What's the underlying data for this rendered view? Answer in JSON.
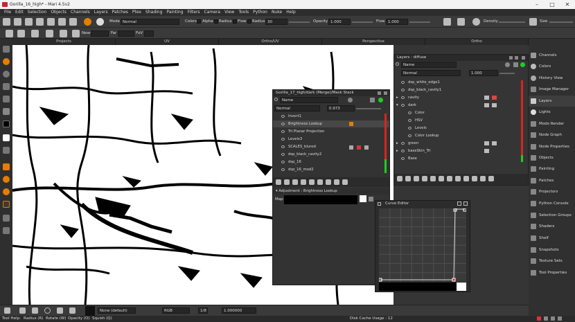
{
  "window": {
    "title": "Gorilla_16_high* - Mari 4.5v2"
  },
  "menu": [
    "File",
    "Edit",
    "Selection",
    "Objects",
    "Channels",
    "Layers",
    "Patches",
    "Ptex",
    "Shading",
    "Painting",
    "Filters",
    "Camera",
    "View",
    "Tools",
    "Python",
    "Nuke",
    "Help"
  ],
  "toolbar1": {
    "mode_label": "Mode",
    "mode_value": "Normal",
    "colors_label": "Colors",
    "alpha_label": "Alpha",
    "radius_label": "Radius",
    "flow_label": "Flow",
    "radius2_label": "Radius",
    "radius_value": "30",
    "opacity_label": "Opacity",
    "opacity_value": "1.000",
    "flow2_label": "Flow",
    "flow_value": "1.000",
    "density_label": "Density",
    "size_label": "Size"
  },
  "toolbar2": {
    "near_label": "Near",
    "far_label": "Far",
    "fov_label": "FoV"
  },
  "view_tabs": [
    "Projects",
    "UV",
    "Ortho/UV",
    "Perspective",
    "Ortho"
  ],
  "layers_panel": {
    "title": "Layers - diffuse",
    "search_mode": "Name",
    "blend_mode": "Normal",
    "opacity": "1.000",
    "layers": [
      {
        "name": "dsp_white_edge1",
        "indent": 1
      },
      {
        "name": "dsp_black_cavity1",
        "indent": 1
      },
      {
        "name": "cavity",
        "indent": 0
      },
      {
        "name": "dark",
        "indent": 0
      },
      {
        "name": "Color",
        "indent": 2
      },
      {
        "name": "HSV",
        "indent": 2
      },
      {
        "name": "Levels",
        "indent": 2
      },
      {
        "name": "Color Lookup",
        "indent": 2
      },
      {
        "name": "green",
        "indent": 0
      },
      {
        "name": "baseSkin_Tri",
        "indent": 0
      },
      {
        "name": "Base",
        "indent": 0
      }
    ]
  },
  "merge_panel": {
    "title": "Gorilla_17_high/dark (Merge)/Mask Stack",
    "search_mode": "Name",
    "blend_mode": "Normal",
    "opacity": "0.973",
    "layers": [
      "Invert1",
      "Brightness Lookup",
      "Tri Planar Projection",
      "Levels3",
      "SCALES_blured",
      "dsp_black_cavity2",
      "dsp_16",
      "dsp_16_mod2"
    ],
    "adjustment_title": "Adjustment : Brightness Lookup",
    "map_label": "Map"
  },
  "curve_editor": {
    "title": "Curve Editor"
  },
  "right_panel": {
    "items": [
      "Channels",
      "Colors",
      "History View",
      "Image Manager",
      "Layers",
      "Lights",
      "Modo Render",
      "Node Graph",
      "Node Properties",
      "Objects",
      "Painting",
      "Patches",
      "Projectors",
      "Python Console",
      "Selection Groups",
      "Shaders",
      "Shelf",
      "Snapshots",
      "Texture Sets",
      "Tool Properties"
    ],
    "active": "Layers"
  },
  "bottom_bar": {
    "preset": "None (default)",
    "channel": "RGB",
    "value": "1.000000",
    "ratio": "1/8"
  },
  "status_bar": {
    "items": [
      "Tool Help:",
      "Radius (R)",
      "Rotate (W)",
      "Opacity (O)",
      "Squish (Q)"
    ],
    "disk_cache": "Disk Cache Usage : 12"
  }
}
